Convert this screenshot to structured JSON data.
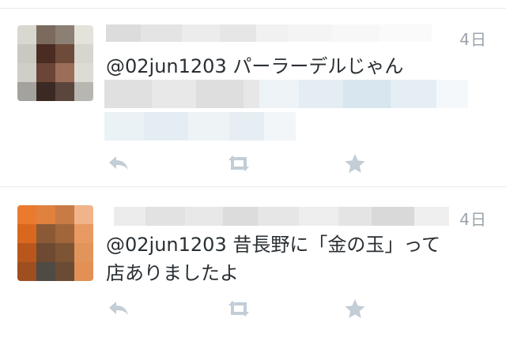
{
  "tweets": [
    {
      "time": "4日",
      "text": "@02jun1203 パーラーデルじゃん"
    },
    {
      "time": "4日",
      "text": "@02jun1203 昔長野に「金の玉」って\n店ありましたよ"
    }
  ],
  "icons": {
    "reply": "reply-icon",
    "retweet": "retweet-icon",
    "favorite": "star-icon"
  },
  "colors": {
    "text": "#292f33",
    "meta": "#9aa3ab",
    "icon": "#c2cdd6",
    "divider": "#e6ecf0"
  }
}
